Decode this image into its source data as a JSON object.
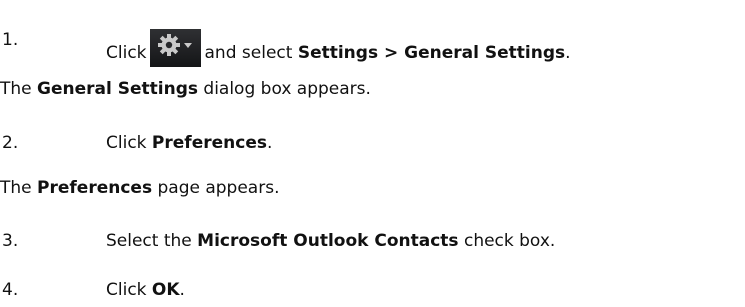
{
  "steps": [
    {
      "number": "1.",
      "lead": "Click",
      "icon": "gear-dropdown-icon",
      "middle": "and select",
      "bold1": "Settings > General Settings",
      "tail": "."
    },
    {
      "number": "2.",
      "lead": "Click",
      "bold1": "Preferences",
      "tail": "."
    },
    {
      "number": "3.",
      "lead": "Select the",
      "bold1": "Microsoft Outlook Contacts",
      "tail": "check box."
    },
    {
      "number": "4.",
      "lead": "Click",
      "bold1": "OK",
      "tail": "."
    }
  ],
  "results": [
    {
      "pre": "The",
      "bold": "General Settings",
      "post": "dialog box appears."
    },
    {
      "pre": "The",
      "bold": "Preferences",
      "post": "page appears."
    }
  ]
}
